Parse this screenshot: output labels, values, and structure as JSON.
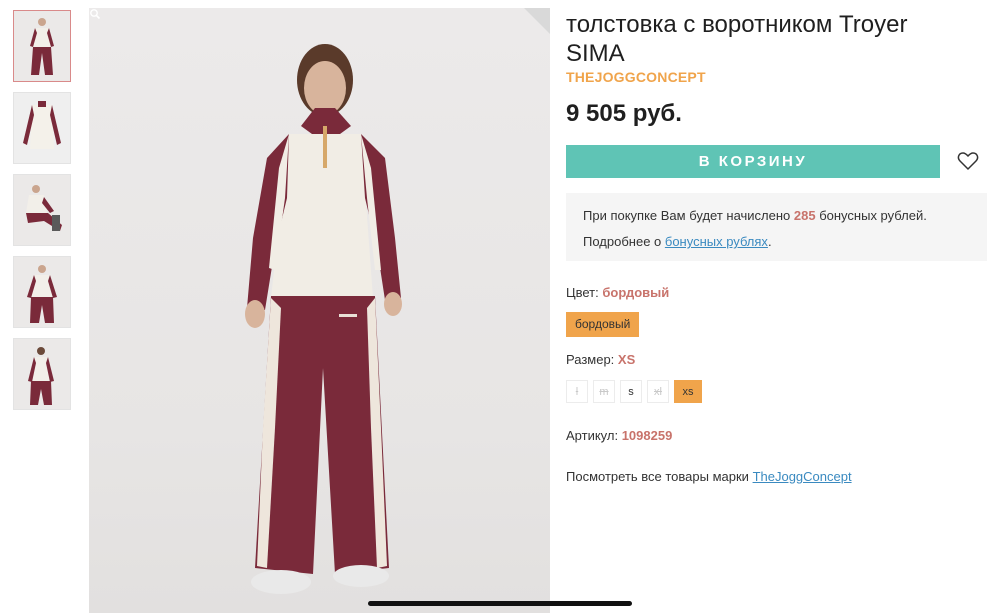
{
  "product": {
    "title": "толстовка с воротником Troyer SIMA",
    "brand": "THEJOGGCONCEPT",
    "price": "9 505 руб.",
    "add_to_cart": "В КОРЗИНУ"
  },
  "bonus": {
    "line1_prefix": "При покупке Вам будет начислено ",
    "points": "285",
    "line1_suffix": " бонусных рублей.",
    "line2_prefix": "Подробнее о ",
    "line2_link": "бонусных рублях",
    "line2_suffix": "."
  },
  "color": {
    "label": "Цвет: ",
    "value": "бордовый",
    "option": "бордовый"
  },
  "size": {
    "label": "Размер: ",
    "value": "XS",
    "options": [
      {
        "label": "l",
        "available": false
      },
      {
        "label": "m",
        "available": false
      },
      {
        "label": "s",
        "available": true
      },
      {
        "label": "xl",
        "available": false
      },
      {
        "label": "xs",
        "available": true,
        "selected": true
      }
    ]
  },
  "sku": {
    "label": "Артикул: ",
    "value": "1098259"
  },
  "brand_link": {
    "prefix": "Посмотреть все товары марки ",
    "link": "TheJoggConcept"
  },
  "thumbnails": [
    "full-front",
    "top-flat",
    "sitting",
    "front-close",
    "back-view"
  ],
  "icons": {
    "favorite": "heart-icon",
    "zoom": "magnifier-icon"
  },
  "colors": {
    "accent_orange": "#f0a44b",
    "teal_button": "#5fc4b5",
    "burgundy": "#7a2a3a",
    "link_blue": "#3a8ac0",
    "bonus_accent": "#c8736b"
  }
}
